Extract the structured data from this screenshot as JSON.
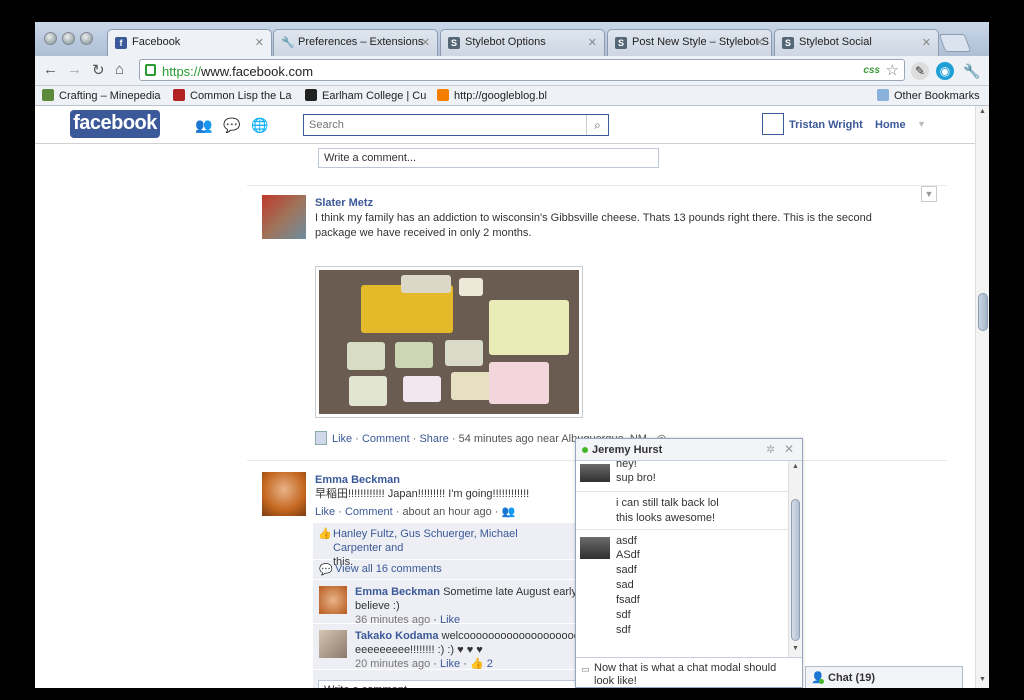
{
  "browser": {
    "tabs": [
      {
        "label": "Facebook",
        "favicon": "f",
        "color": "#3b5998"
      },
      {
        "label": "Preferences – Extensions",
        "favicon": "🔧",
        "color": "#666"
      },
      {
        "label": "Stylebot Options",
        "favicon": "S",
        "color": "#556677"
      },
      {
        "label": "Post New Style – Stylebot S",
        "favicon": "S",
        "color": "#556677"
      },
      {
        "label": "Stylebot Social",
        "favicon": "S",
        "color": "#556677"
      }
    ],
    "url_scheme": "https://",
    "url_host": "www.facebook.com",
    "css_badge": "css",
    "bookmarks": [
      {
        "label": "Crafting – Minepedia",
        "color": "#5a8a3a"
      },
      {
        "label": "Common Lisp the La",
        "color": "#b22222"
      },
      {
        "label": "Earlham College | Cu",
        "color": "#222222"
      },
      {
        "label": "http://googleblog.bl",
        "color": "#f57d00"
      }
    ],
    "other_bookmarks": "Other Bookmarks"
  },
  "fb": {
    "logo": "facebook",
    "search_placeholder": "Search",
    "user_name": "Tristan Wright",
    "home": "Home",
    "write_comment": "Write a comment...",
    "post1": {
      "author": "Slater Metz",
      "text": "I think my family has an addiction to wisconsin's Gibbsville cheese. Thats 13 pounds right there. This is the second package we have received in only 2 months.",
      "like": "Like",
      "comment": "Comment",
      "share": "Share",
      "time": "54 minutes ago near Albuquerque, NM"
    },
    "post2": {
      "author": "Emma Beckman",
      "text": "早稲田!!!!!!!!!!!! Japan!!!!!!!!! I'm going!!!!!!!!!!!!",
      "like": "Like",
      "comment": "Comment",
      "time": "about an hour ago",
      "likers": "Hanley Fultz, Gus Schuerger, Michael Carpenter and",
      "likers_end": "this.",
      "view_all": "View all 16 comments",
      "comments": [
        {
          "author": "Emma Beckman",
          "text": "Sometime late August early Se",
          "text2": "believe :)",
          "time": "36 minutes ago",
          "like": "Like"
        },
        {
          "author": "Takako Kodama",
          "text": "welcoooooooooooooooooooooomeee",
          "text2": "eeeeeeeee!!!!!!!! :) :) ♥ ♥ ♥",
          "time": "20 minutes ago",
          "like": "Like",
          "likes": "2"
        }
      ]
    }
  },
  "chat": {
    "with": "Jeremy Hurst",
    "messages_top": [
      "hey!",
      "sup bro!"
    ],
    "messages_mid": [
      "i can still talk back lol",
      "this looks awesome!"
    ],
    "messages_bottom": [
      "asdf",
      "ASdf",
      "sadf",
      "sad",
      "fsadf",
      "sdf",
      "sdf"
    ],
    "composer_text": "Now that is what a chat modal should look like!",
    "bar_label": "Chat (19)"
  }
}
